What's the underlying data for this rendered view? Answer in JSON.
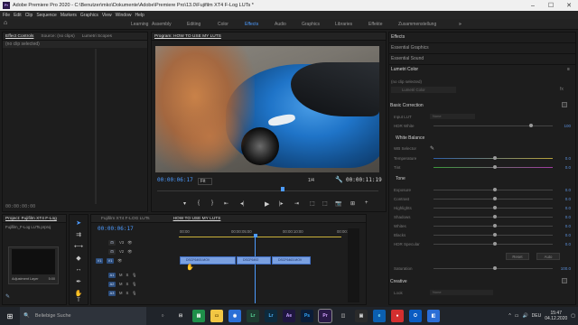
{
  "titlebar": {
    "app_icon": "Pr",
    "title": "Adobe Premiere Pro 2020 - C:\\Benutzer\\mko\\Dokumente\\Adobe\\Premiere Pro\\13.0\\Fujifilm XT4 F-Log LUTs *"
  },
  "menu": [
    "Datei",
    "Bearbeiten",
    "Clip",
    "Sequenz",
    "Marken",
    "Grafiken",
    "Ansicht",
    "Fenster",
    "Hilfe"
  ],
  "menu_display": "File  Edit  Clip  Sequence  Markers  Graphics  View  Window  Help",
  "menu_labels": {
    "m0": "File",
    "m1": "Edit",
    "m2": "Clip",
    "m3": "Sequence",
    "m4": "Markers",
    "m5": "Graphics",
    "m6": "View",
    "m7": "Window",
    "m8": "Help"
  },
  "workspaces": {
    "w0": "Learning",
    "w1": "Assembly",
    "w2": "Editing",
    "w3": "Color",
    "w4": "Effects",
    "w5": "Audio",
    "w6": "Graphics",
    "w7": "Libraries",
    "w8": "Effekte",
    "w9": "Zusammenstellung",
    "more": "»"
  },
  "source_panel": {
    "tab0": "Effect Controls",
    "tab1": "Source: (no clips)",
    "tab2": "Lumetri Scopes",
    "no_clip": "(no clip selected)",
    "timecode": "00:00:00:00"
  },
  "program": {
    "tab": "Program: HOW TO USE MY LUTS",
    "timecode_left": "00:00:06:17",
    "fit": "Fit",
    "ratio": "1/4",
    "timecode_right": "00:00:11:19"
  },
  "project": {
    "tab0": "Project: Fujifilm XT4 F-Log",
    "tab1": "Media Browser",
    "file": "Fujifilm_F-Log LUTs.prproj",
    "item_label": "Adjustment Layer",
    "item_duration": "5:00"
  },
  "timeline": {
    "tab0": "Fujifilm XT4 F-LOG LUTs",
    "tab1": "HOW TO USE MY LUTS",
    "timecode": "00:00:06:17",
    "ruler": {
      "r0": "00:00",
      "r1": "00:00:05:00",
      "r2": "00:00:10:00",
      "r3": "00:00:15:00"
    },
    "tracks": {
      "v3": "V3",
      "v2": "V2",
      "v1": "V1",
      "a1": "A1",
      "a2": "A2",
      "a3": "A3"
    },
    "clips": {
      "c1": "DSCF6493.MOV",
      "c2": "DSCF6492",
      "c3": "DSCF6463.MOV"
    }
  },
  "right_panel": {
    "effects": "Effects",
    "essential_graphics": "Essential Graphics",
    "essential_sound": "Essential Sound",
    "lumetri_color": "Lumetri Color",
    "no_clip": "(no clip selected)",
    "lumetri_dropdown": "Lumetri Color",
    "basic_correction": "Basic Correction",
    "input_lut": "Input LUT",
    "input_lut_val": "None",
    "hdr_white": "HDR White",
    "white_balance": "White Balance",
    "wb_selector": "WB Selector",
    "temperature": "Temperature",
    "tint": "Tint",
    "tone": "Tone",
    "exposure": "Exposure",
    "contrast": "Contrast",
    "highlights": "Highlights",
    "shadows": "Shadows",
    "whites": "Whites",
    "blacks": "Blacks",
    "hdr_specular": "HDR Specular",
    "reset": "Reset",
    "auto": "Auto",
    "saturation": "Saturation",
    "creative": "Creative",
    "look": "Look",
    "look_val": "None",
    "zero": "0.0",
    "hundred": "100",
    "sat_val": "100.0"
  },
  "taskbar": {
    "search_placeholder": "Beliebige Suche",
    "time": "15:47",
    "date": "04.12.2020",
    "lang": "DEU"
  },
  "colors": {
    "accent": "#4d9bff",
    "clip": "#7aa0e0",
    "taskbar": "#20242a"
  }
}
